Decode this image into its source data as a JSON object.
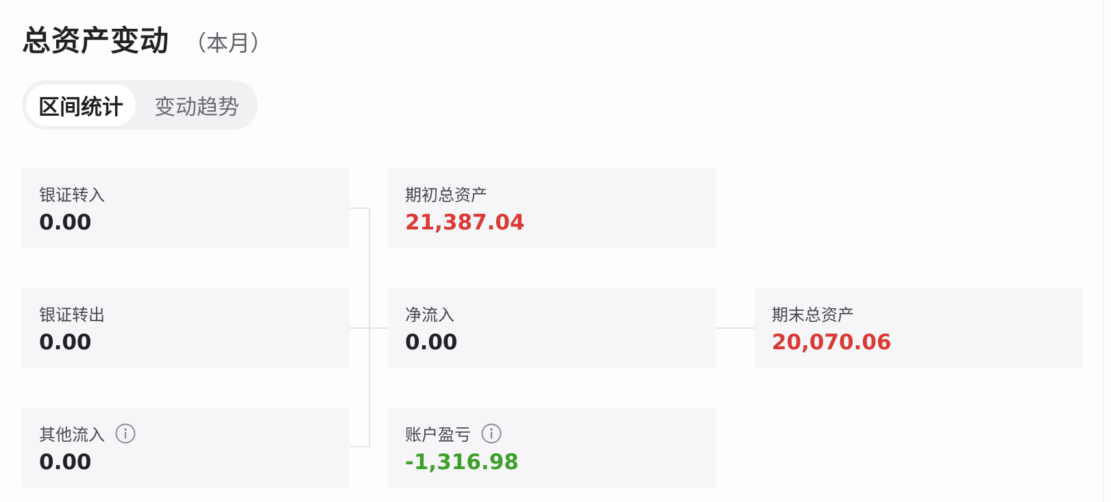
{
  "header": {
    "title": "总资产变动",
    "subtitle": "（本月）"
  },
  "tabs": [
    {
      "label": "区间统计",
      "active": true
    },
    {
      "label": "变动趋势",
      "active": false
    }
  ],
  "cards": {
    "bank_in": {
      "label": "银证转入",
      "value": "0.00"
    },
    "bank_out": {
      "label": "银证转出",
      "value": "0.00"
    },
    "other_in": {
      "label": "其他流入",
      "value": "0.00",
      "icon": "info-icon"
    },
    "start_assets": {
      "label": "期初总资产",
      "value": "21,387.04"
    },
    "net_inflow": {
      "label": "净流入",
      "value": "0.00"
    },
    "profit_loss": {
      "label": "账户盈亏",
      "value": "-1,316.98",
      "icon": "info-icon"
    },
    "end_assets": {
      "label": "期末总资产",
      "value": "20,070.06"
    }
  },
  "colors": {
    "positive": "#d93a35",
    "negative": "#3f9f2b",
    "neutral": "#222226"
  }
}
